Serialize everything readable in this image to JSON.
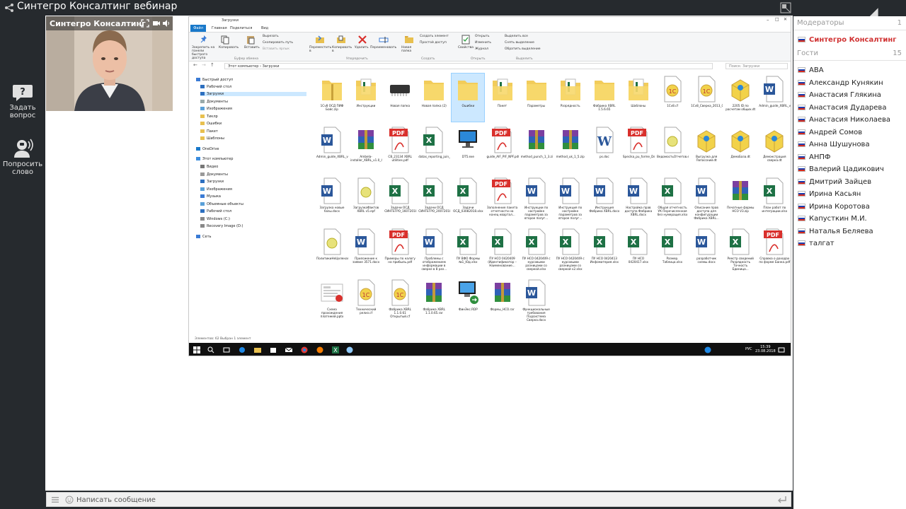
{
  "app": {
    "title": "Синтегро Консалтинг вебинар"
  },
  "rail": {
    "ask_label": "Задать вопрос",
    "ask_line1": "Задать",
    "ask_line2": "вопрос",
    "speak_line1": "Попросить",
    "speak_line2": "слово"
  },
  "webcam": {
    "name": "Синтегро Консалтинг"
  },
  "chat": {
    "placeholder": "Написать сообщение"
  },
  "panel": {
    "moderators_label": "Модераторы",
    "moderators_count": "1",
    "moderators": [
      "Синтегро Консалтинг"
    ],
    "guests_label": "Гости",
    "guests_count": "15",
    "guests": [
      "АВА",
      "Александр Кунякин",
      "Анастасия Глякина",
      "Анастасия Дударева",
      "Анастасия Николаева",
      "Андрей Сомов",
      "Анна Шушунова",
      "АНПФ",
      "Валерий Цадикович",
      "Дмитрий Зайцев",
      "Ирина Касьян",
      "Ирина Коротова",
      "Капусткин М.И.",
      "Наталья Беляева",
      "талгат"
    ]
  },
  "explorer": {
    "title": "Загрузки",
    "tabs": [
      "Файл",
      "Главная",
      "Поделиться",
      "Вид"
    ],
    "ribbon": {
      "pin": "Закрепить на панели быстрого доступа",
      "copy": "Копировать",
      "paste": "Вставить",
      "cut": "Вырезать",
      "copy_path": "Скопировать путь",
      "paste_shortcut": "Вставить ярлык",
      "move_to": "Переместить в",
      "copy_to": "Копировать в",
      "delete": "Удалить",
      "rename": "Переименовать",
      "new_folder": "Новая папка",
      "new_item": "Создать элемент",
      "easy_access": "Простой доступ",
      "properties": "Свойства",
      "open": "Открыть",
      "edit": "Изменить",
      "history": "Журнал",
      "select_all": "Выделить все",
      "select_none": "Снять выделение",
      "invert": "Обратить выделение",
      "g_clipboard": "Буфер обмена",
      "g_organize": "Упорядочить",
      "g_new": "Создать",
      "g_open": "Открыть",
      "g_select": "Выделить"
    },
    "address": "Этот компьютер  ›  Загрузки",
    "search_placeholder": "Поиск: Загрузки",
    "nav": {
      "quick": "Быстрый доступ",
      "desktop": "Рабочий стол",
      "downloads": "Загрузки",
      "documents": "Документы",
      "pictures": "Изображения",
      "tick": "Тиклр",
      "errors": "Ошибки",
      "packet": "Пакет",
      "templates": "Шаблоны",
      "onedrive": "OneDrive",
      "this_pc": "Этот компьютер",
      "video": "Видео",
      "docs2": "Документы",
      "downloads2": "Загрузки",
      "pictures2": "Изображения",
      "music": "Музыка",
      "objects3d": "Объемные объекты",
      "desktop2": "Рабочий стол",
      "win_c": "Windows (C:)",
      "recovery": "Recovery Image (D:)",
      "network": "Сеть"
    },
    "files": [
      {
        "name": "1Cv8 ОСД ПИФ Бойс.zip",
        "type": "zipfolder"
      },
      {
        "name": "Инструкции",
        "type": "folderdoc"
      },
      {
        "name": "Новая папка",
        "type": "chip"
      },
      {
        "name": "Новая папка (2)",
        "type": "folder"
      },
      {
        "name": "Ошибки",
        "type": "folder"
      },
      {
        "name": "Пакет",
        "type": "folderdoc"
      },
      {
        "name": "Параметры",
        "type": "folder"
      },
      {
        "name": "Разрядность",
        "type": "folderdoc"
      },
      {
        "name": "Фабрика XBRL 1.5.6.65",
        "type": "folder"
      },
      {
        "name": "Шаблоны",
        "type": "folderdoc"
      },
      {
        "name": "1Cv8.cf",
        "type": "cf"
      },
      {
        "name": "1Cv8_Сверка_2013_06_01_1105.cf",
        "type": "cf"
      },
      {
        "name": "2205 ID по расчетам общих.dt",
        "type": "dt"
      },
      {
        "name": "Admin_guide_XBRL_v1.0_общий_SuperWiki.docx",
        "type": "word"
      },
      {
        "name": "Admin_guide_XBRL_v1.0_обмен_Синтегро_4.0.6.docx",
        "type": "word"
      },
      {
        "name": "Ambela-installer_XBRL_v1.0_451.zip",
        "type": "rar"
      },
      {
        "name": "CB_23134 XBRL utilities.pdf",
        "type": "pdf"
      },
      {
        "name": "datas_reporting_juin_2018.xlsx",
        "type": "excel"
      },
      {
        "name": "DT5.exe",
        "type": "monitor"
      },
      {
        "name": "guide_AIF_PIF_NPF.pdf",
        "type": "pdf"
      },
      {
        "name": "method_punch_1_3.zip",
        "type": "rar"
      },
      {
        "name": "method_uk_1_5.zip",
        "type": "rar"
      },
      {
        "name": "ps.doc",
        "type": "wordold"
      },
      {
        "name": "Specika_pu_forme_Demin_2015.06.pdf",
        "type": "pdf"
      },
      {
        "name": "ВедомостьОтчетов.epf",
        "type": "epf"
      },
      {
        "name": "Выгрузка для Попасский.dt",
        "type": "dt"
      },
      {
        "name": "ДемоБаза.dt",
        "type": "dt"
      },
      {
        "name": "Демонстрация сверка.dt",
        "type": "dt"
      },
      {
        "name": "Загрузка новые базы.docx",
        "type": "word"
      },
      {
        "name": "ЗагрузкаФактов XBRL v5.epf",
        "type": "epf"
      },
      {
        "name": "Задачи ОСД СИНТЕГРО_16072018.xlsx",
        "type": "excel"
      },
      {
        "name": "Задачи ОСД СИНТЕГРО_20072018.xlsx",
        "type": "excel"
      },
      {
        "name": "Задачи ОСД_03082018.xlsx",
        "type": "excel"
      },
      {
        "name": "Заполнение пакета отчетности на конец квартал...",
        "type": "pdf"
      },
      {
        "name": "Инструкции по настройке параметров за второе полуг...",
        "type": "word"
      },
      {
        "name": "Инструкция по настройке параметров за второе полуг...",
        "type": "word"
      },
      {
        "name": "Инструкция Фабрика XBRL.docx",
        "type": "word"
      },
      {
        "name": "Настройка прав доступа Фабрика XBRL.docx",
        "type": "word"
      },
      {
        "name": "Общая отчетность УК Перечисленная без нумерация.xlsx",
        "type": "excel"
      },
      {
        "name": "Описание прав доступа для конфигурации Фабрика XBRL...",
        "type": "word"
      },
      {
        "name": "Печатные формы НСО V3.zip",
        "type": "rar"
      },
      {
        "name": "План работ по интеграции.xlsx",
        "type": "excel"
      },
      {
        "name": "ПолитикиНеЦеленаяЭскалацияОтчета.epf",
        "type": "epf"
      },
      {
        "name": "Приложение к заявке 3571.docx",
        "type": "word"
      },
      {
        "name": "Примеры по налогу на прибыль.pdf",
        "type": "pdf"
      },
      {
        "name": "Проблемы с отображением информации в сверке в 8 раз...",
        "type": "word"
      },
      {
        "name": "ПУ ВФО Формы №1_Юд.xlsx",
        "type": "excel"
      },
      {
        "name": "ПУ НСО 0420409 (Идентификатор – Наименование...",
        "type": "excel"
      },
      {
        "name": "ПУ НСО 0420409 с курсовыми разницами со сверкой.xlsx",
        "type": "excel"
      },
      {
        "name": "ПУ НСО 0420409 с курсовыми разницами со сверкой v2.xlsx",
        "type": "excel"
      },
      {
        "name": "ПУ НСО 0420413 Инфоматерия.xlsx",
        "type": "excel"
      },
      {
        "name": "ПУ НСО 0420417.xlsx",
        "type": "excel"
      },
      {
        "name": "Размер. Таблица.xlsx",
        "type": "excel"
      },
      {
        "name": "разработчик схемы.docx",
        "type": "word"
      },
      {
        "name": "Реестр сведений Разрядность Точность Единица...",
        "type": "excel"
      },
      {
        "name": "Справка о доходах по форме Банка.pdf",
        "type": "pdf"
      },
      {
        "name": "Схема прохождения платежей.pptx",
        "type": "pptx"
      },
      {
        "name": "Технический релиз.cf",
        "type": "cf"
      },
      {
        "name": "Фабрика XBRL 1.1.0.61 Открытый.cf",
        "type": "cf"
      },
      {
        "name": "Фабрика XBRL 1.1.0.65.rar",
        "type": "rar"
      },
      {
        "name": "ФинЭкс.RDP",
        "type": "rdp"
      },
      {
        "name": "Формы_НСО.rar",
        "type": "rar"
      },
      {
        "name": "Функциональные требования Подсистема Сверка.docx",
        "type": "word"
      }
    ],
    "status": "Элементов: 62    Выбран 1 элемент",
    "clock_time": "15:39",
    "clock_date": "23.08.2018",
    "lang": "РУС"
  },
  "colors": {
    "moderator": "#d03232",
    "selection": "#cce8ff",
    "background": "#262a2e",
    "excel": "#1e7145",
    "word": "#2b579a",
    "pdf": "#d9302c"
  }
}
